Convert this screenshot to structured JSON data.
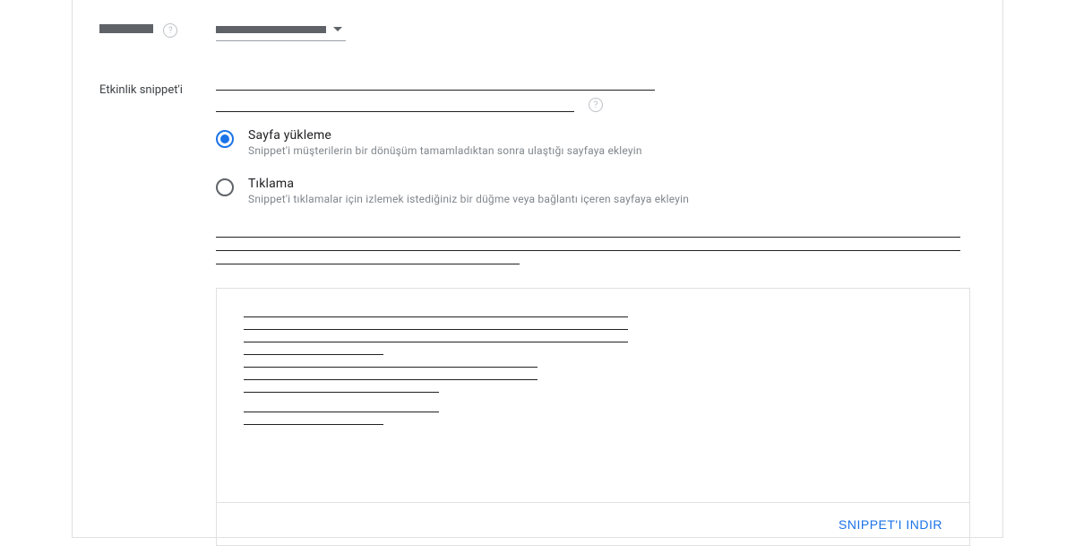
{
  "form": {
    "snippet_label": "Etkinlik snippet'i"
  },
  "radios": {
    "page_load": {
      "title": "Sayfa yükleme",
      "desc": "Snippet'i müşterilerin bir dönüşüm tamamladıktan sonra ulaştığı sayfaya ekleyin"
    },
    "click": {
      "title": "Tıklama",
      "desc": "Snippet'i tıklamalar için izlemek istediğiniz bir düğme veya bağlantı içeren sayfaya ekleyin"
    }
  },
  "actions": {
    "download": "SNIPPET'I INDIR"
  }
}
